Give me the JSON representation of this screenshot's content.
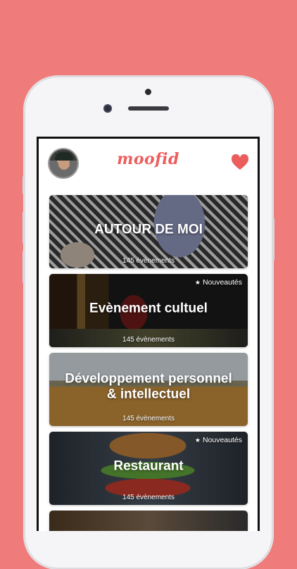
{
  "app": {
    "logo_text": "moofid",
    "avatar": "user-avatar",
    "favorite_icon": "heart-icon",
    "accent_color": "#ec5d5d",
    "background_color": "#f07b7b"
  },
  "categories": [
    {
      "title": "AUTOUR DE MOI",
      "count": "145 évènements",
      "badge": ""
    },
    {
      "title": "Evènement cultuel",
      "count": "145 évènements",
      "badge": "Nouveautés"
    },
    {
      "title": "Développement personnel\n& intellectuel",
      "count": "145 évènements",
      "badge": ""
    },
    {
      "title": "Restaurant",
      "count": "145 évènements",
      "badge": "Nouveautés"
    }
  ]
}
